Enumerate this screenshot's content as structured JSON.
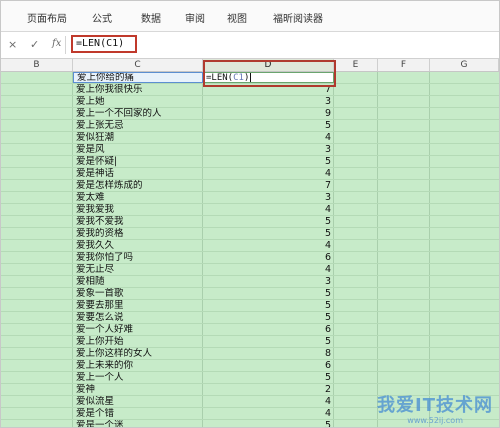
{
  "menu": {
    "items": [
      "页面布局",
      "公式",
      "数据",
      "审阅",
      "视图",
      "福昕阅读器"
    ]
  },
  "formula_bar": {
    "cancel_icon": "×",
    "confirm_icon": "✓",
    "fx_label": "fx",
    "formula": "=LEN(C1)"
  },
  "columns": [
    "B",
    "C",
    "D",
    "E",
    "F",
    "G"
  ],
  "active_column": "D",
  "editing_cell": {
    "prefix": "=LEN(",
    "ref": "C1",
    "suffix": ")"
  },
  "rows": [
    {
      "c": "爱上你给的痛",
      "d": ""
    },
    {
      "c": "爱上你我很快乐",
      "d": "7"
    },
    {
      "c": "爱上她",
      "d": "3"
    },
    {
      "c": "爱上一个不回家的人",
      "d": "9"
    },
    {
      "c": "爱上张无忌",
      "d": "5"
    },
    {
      "c": "爱似狂潮",
      "d": "4"
    },
    {
      "c": "爱是风",
      "d": "3"
    },
    {
      "c": "爱是怀疑|",
      "d": "5"
    },
    {
      "c": "爱是神话",
      "d": "4"
    },
    {
      "c": "爱是怎样炼成的",
      "d": "7"
    },
    {
      "c": "爱太难",
      "d": "3"
    },
    {
      "c": "爱我爱我",
      "d": "4"
    },
    {
      "c": "爱我不爱我",
      "d": "5"
    },
    {
      "c": "爱我的资格",
      "d": "5"
    },
    {
      "c": "爱我久久",
      "d": "4"
    },
    {
      "c": "爱我你怕了吗",
      "d": "6"
    },
    {
      "c": "爱无止尽",
      "d": "4"
    },
    {
      "c": "爱相随",
      "d": "3"
    },
    {
      "c": "爱象一首歌",
      "d": "5"
    },
    {
      "c": "爱要去那里",
      "d": "5"
    },
    {
      "c": "爱要怎么说",
      "d": "5"
    },
    {
      "c": "爱一个人好难",
      "d": "6"
    },
    {
      "c": "爱上你开始",
      "d": "5"
    },
    {
      "c": "爱上你这样的女人",
      "d": "8"
    },
    {
      "c": "爱上未来的你",
      "d": "6"
    },
    {
      "c": "爱上一个人",
      "d": "5"
    },
    {
      "c": "爱神",
      "d": "2"
    },
    {
      "c": "爱似流星",
      "d": "4"
    },
    {
      "c": "爱是个错",
      "d": "4"
    },
    {
      "c": "爱是一个迷",
      "d": "5"
    }
  ],
  "watermark": {
    "text": "我爱IT技术网",
    "url": "www.52ij.com"
  }
}
